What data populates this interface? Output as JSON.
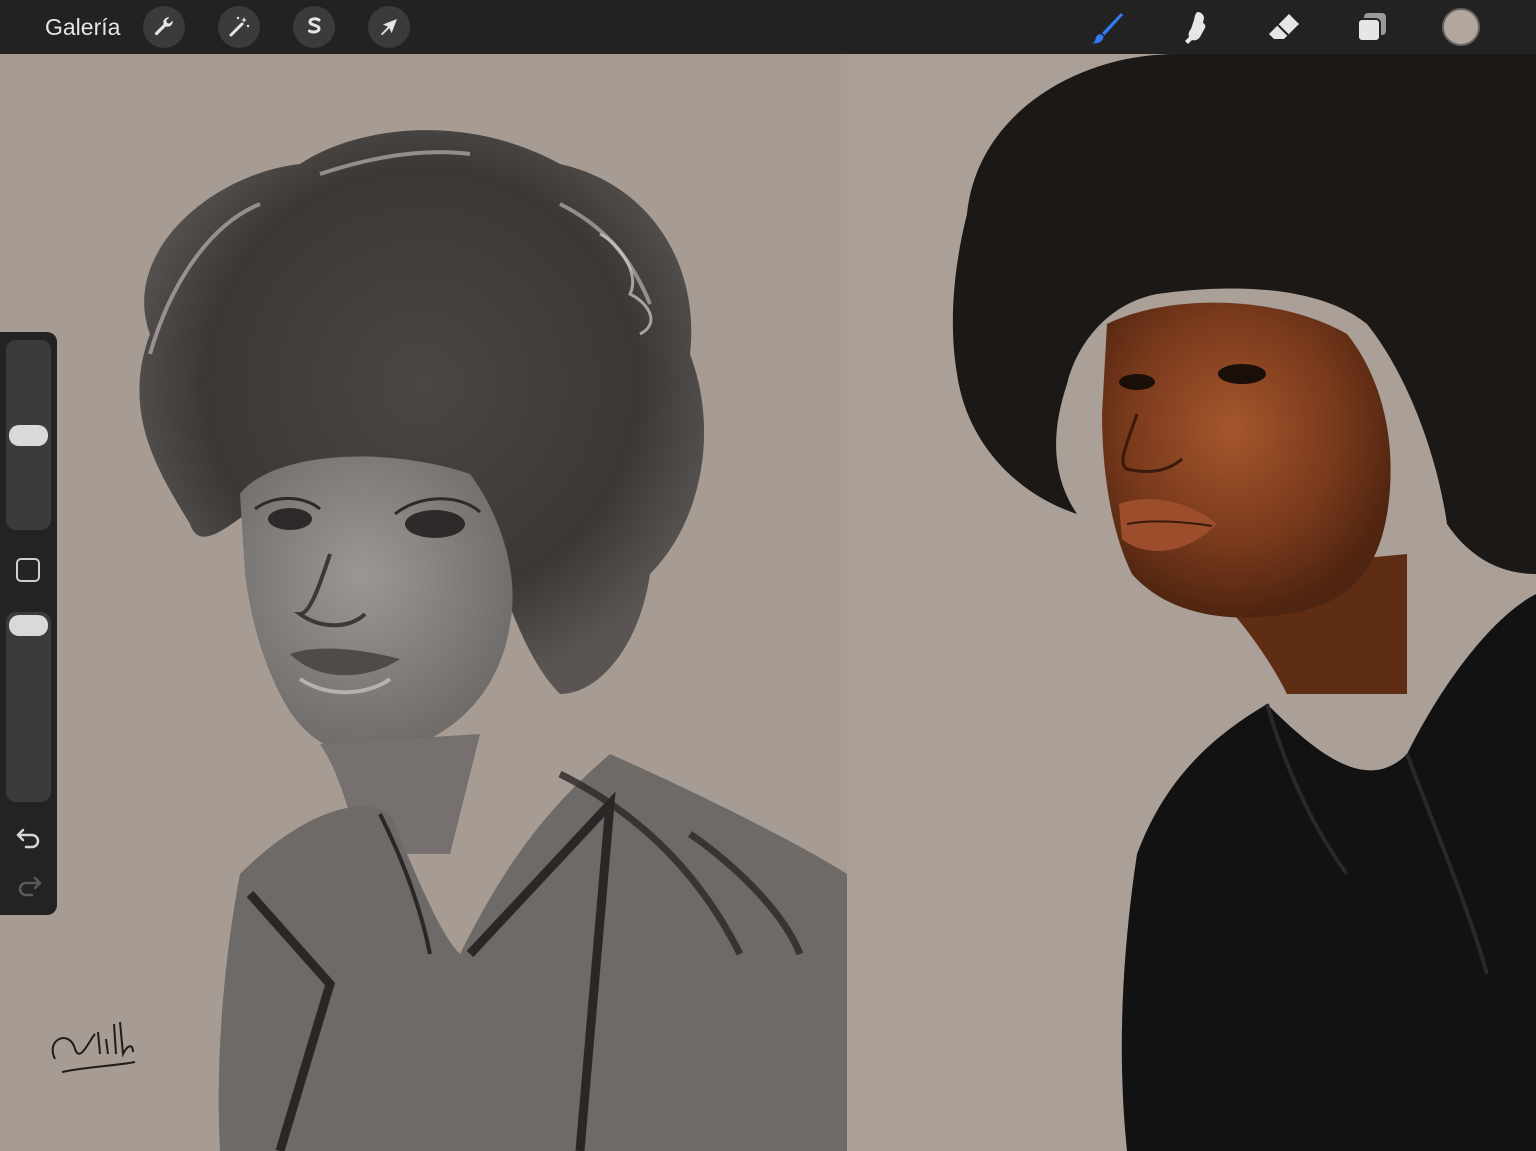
{
  "topbar": {
    "gallery_label": "Galería",
    "left_tools": [
      {
        "name": "actions",
        "icon": "wrench-icon"
      },
      {
        "name": "adjustments",
        "icon": "magic-wand-icon"
      },
      {
        "name": "selection",
        "icon": "selection-s-icon"
      },
      {
        "name": "transform",
        "icon": "arrow-cursor-icon"
      }
    ],
    "right_tools": [
      {
        "name": "brush",
        "icon": "brush-icon",
        "active": true
      },
      {
        "name": "smudge",
        "icon": "smudge-finger-icon"
      },
      {
        "name": "eraser",
        "icon": "eraser-icon"
      },
      {
        "name": "layers",
        "icon": "layers-icon"
      }
    ],
    "current_color": "#b2a79f",
    "active_tool_color": "#2f7cf6"
  },
  "sidebar": {
    "brush_size_level": 0.5,
    "opacity_level": 1.0,
    "modifier_icon": "square-modifier-icon",
    "undo_icon": "undo-arrow-icon",
    "redo_icon": "redo-arrow-icon",
    "redo_enabled": false
  },
  "canvas": {
    "sketch_background": "#a79c93",
    "photo_background": "#aaa098",
    "signature": "Villers"
  }
}
